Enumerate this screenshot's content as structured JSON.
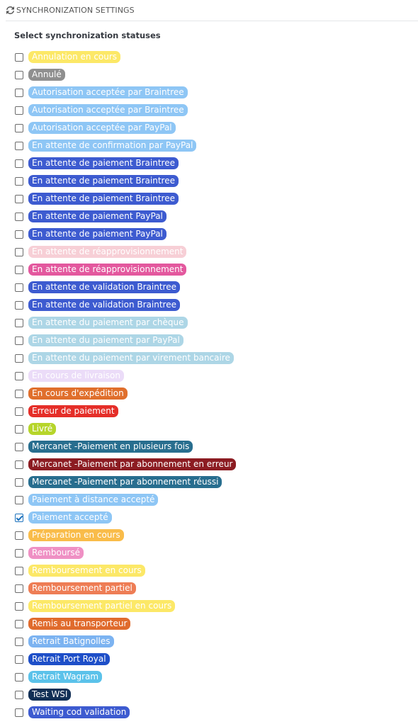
{
  "header": {
    "title": "SYNCHRONIZATION SETTINGS",
    "icon": "refresh-icon"
  },
  "section": {
    "label": "Select synchronization statuses"
  },
  "statuses": [
    {
      "label": "Annulation en cours",
      "color": "#fce867",
      "checked": false
    },
    {
      "label": "Annulé",
      "color": "#8f8f8f",
      "checked": false
    },
    {
      "label": "Autorisation acceptée par Braintree",
      "color": "#8ec6f5",
      "checked": false
    },
    {
      "label": "Autorisation acceptée par Braintree",
      "color": "#8ec6f5",
      "checked": false
    },
    {
      "label": "Autorisation acceptée par PayPal",
      "color": "#8ec6f5",
      "checked": false
    },
    {
      "label": "En attente de confirmation par PayPal",
      "color": "#8ec6f5",
      "checked": false
    },
    {
      "label": "En attente de paiement Braintree",
      "color": "#3d5bd0",
      "checked": false
    },
    {
      "label": "En attente de paiement Braintree",
      "color": "#3d5bd0",
      "checked": false
    },
    {
      "label": "En attente de paiement Braintree",
      "color": "#3d5bd0",
      "checked": false
    },
    {
      "label": "En attente de paiement PayPal",
      "color": "#3d5bd0",
      "checked": false
    },
    {
      "label": "En attente de paiement PayPal",
      "color": "#3d5bd0",
      "checked": false
    },
    {
      "label": "En attente de réapprovisionnement",
      "color": "#f7cfd6",
      "checked": false
    },
    {
      "label": "En attente de réapprovisionnement",
      "color": "#e3589e",
      "checked": false
    },
    {
      "label": "En attente de validation Braintree",
      "color": "#3d5bd0",
      "checked": false
    },
    {
      "label": "En attente de validation Braintree",
      "color": "#3d5bd0",
      "checked": false
    },
    {
      "label": "En attente du paiement par chèque",
      "color": "#add6e6",
      "checked": false
    },
    {
      "label": "En attente du paiement par PayPal",
      "color": "#add6e6",
      "checked": false
    },
    {
      "label": "En attente du paiement par virement bancaire",
      "color": "#add6e6",
      "checked": false
    },
    {
      "label": "En cours de livraison",
      "color": "#ebdcf8",
      "checked": false
    },
    {
      "label": "En cours d'expédition",
      "color": "#e06f2c",
      "checked": false
    },
    {
      "label": "Erreur de paiement",
      "color": "#e52e28",
      "checked": false
    },
    {
      "label": "Livré",
      "color": "#b6d52b",
      "checked": false
    },
    {
      "label": "Mercanet -Paiement en plusieurs fois",
      "color": "#286e8f",
      "checked": false
    },
    {
      "label": "Mercanet -Paiement par abonnement en erreur",
      "color": "#8c1c22",
      "checked": false
    },
    {
      "label": "Mercanet -Paiement par abonnement réussi",
      "color": "#286e8f",
      "checked": false
    },
    {
      "label": "Paiement à distance accepté",
      "color": "#8ec6f5",
      "checked": false
    },
    {
      "label": "Paiement accepté",
      "color": "#8ec6f5",
      "checked": true
    },
    {
      "label": "Préparation en cours",
      "color": "#f9bc4a",
      "checked": false
    },
    {
      "label": "Remboursé",
      "color": "#ef90c4",
      "checked": false
    },
    {
      "label": "Remboursement en cours",
      "color": "#fce867",
      "checked": false
    },
    {
      "label": "Remboursement partiel",
      "color": "#ee7d55",
      "checked": false
    },
    {
      "label": "Remboursement partiel en cours",
      "color": "#fce867",
      "checked": false
    },
    {
      "label": "Remis au transporteur",
      "color": "#e06b2d",
      "checked": false
    },
    {
      "label": "Retrait Batignolles",
      "color": "#7cb3f1",
      "checked": false
    },
    {
      "label": "Retrait Port Royal",
      "color": "#1e4fc8",
      "checked": false
    },
    {
      "label": "Retrait Wagram",
      "color": "#5bc2ea",
      "checked": false
    },
    {
      "label": "Test WSI",
      "color": "#112f55",
      "checked": false
    },
    {
      "label": "Waiting cod validation",
      "color": "#3d5bd0",
      "checked": false
    }
  ]
}
